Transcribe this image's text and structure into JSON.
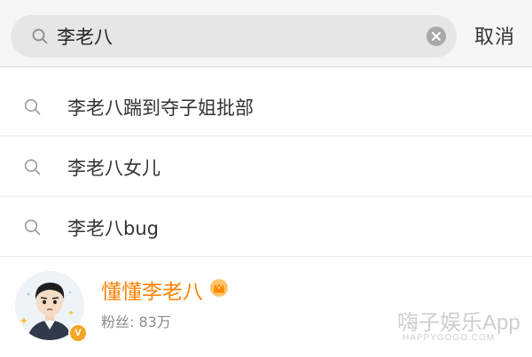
{
  "search": {
    "query": "李老八",
    "cancel_label": "取消"
  },
  "suggestions": [
    {
      "text": "李老八踹到夺子姐批部",
      "icon": "search-icon"
    },
    {
      "text": "李老八女儿",
      "icon": "search-icon"
    },
    {
      "text": "李老八bug",
      "icon": "search-icon"
    }
  ],
  "user_result": {
    "name": "懂懂李老八",
    "followers": "粉丝: 83万",
    "verified_badge": "V",
    "badge_icon": "crown-icon"
  },
  "watermark": {
    "text": "嗨子娱乐App",
    "sub": "HAPPYGOGO.COM"
  },
  "colors": {
    "accent_orange": "#ff8200",
    "badge_gold": "#f5a623",
    "search_box_bg": "#e6e6e6",
    "header_bg": "#f6f6f6"
  }
}
